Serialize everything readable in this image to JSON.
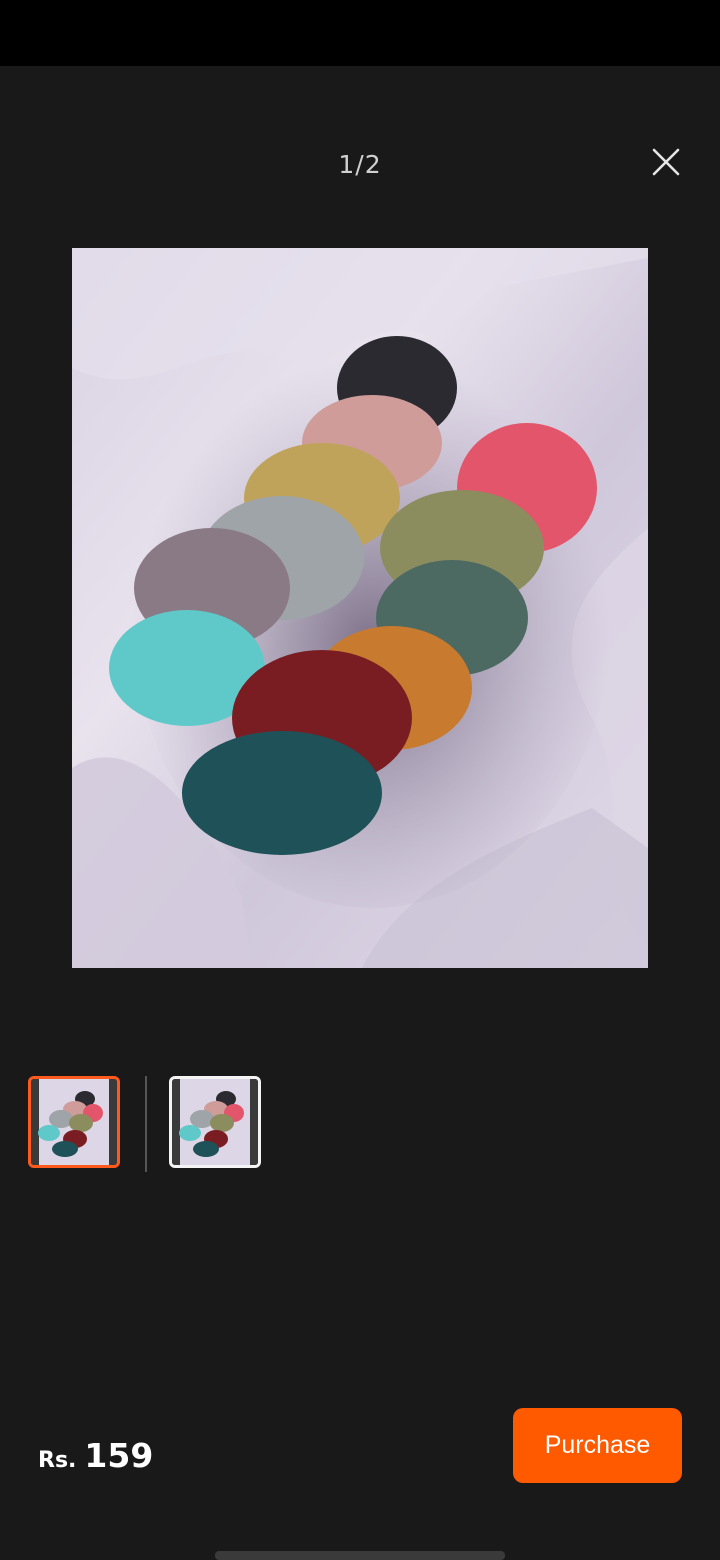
{
  "header": {
    "counter": "1/2",
    "close_icon": "close-icon"
  },
  "gallery": {
    "main_image_alt": "product-image-scrunchies",
    "thumbnails": [
      {
        "icon": "thumbnail-image",
        "selected": true
      },
      {
        "icon": "thumbnail-image",
        "selected": false
      }
    ]
  },
  "footer": {
    "currency": "Rs.",
    "price": "159",
    "purchase_label": "Purchase"
  },
  "colors": {
    "accent": "#ff5a00",
    "background": "#191919",
    "status_bar": "#000000"
  }
}
